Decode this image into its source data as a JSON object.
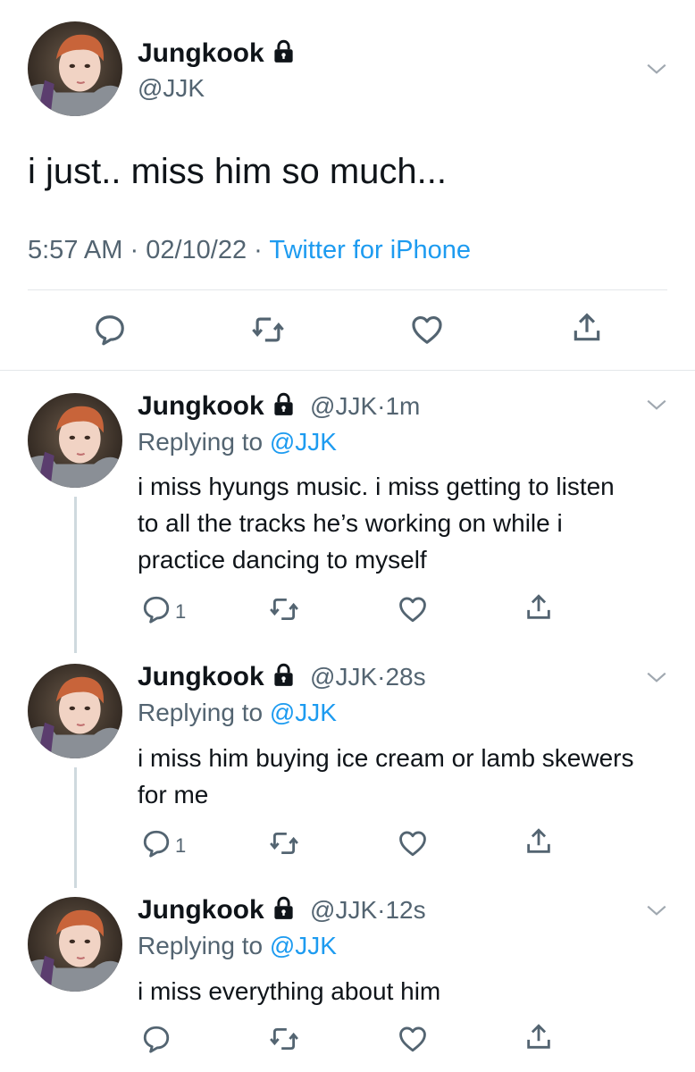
{
  "main_tweet": {
    "name": "Jungkook",
    "handle": "@JJK",
    "text": "i just.. miss him so much...",
    "time": "5:57 AM",
    "date": "02/10/22",
    "source": "Twitter for iPhone"
  },
  "replies": [
    {
      "name": "Jungkook",
      "handle": "@JJK",
      "age": "1m",
      "replying_label": "Replying to",
      "replying_to": "@JJK",
      "text": "i miss hyungs music. i miss getting to listen to all the tracks he’s working on while i practice dancing to myself",
      "reply_count": "1"
    },
    {
      "name": "Jungkook",
      "handle": "@JJK",
      "age": "28s",
      "replying_label": "Replying to",
      "replying_to": "@JJK",
      "text": "i miss him buying ice cream or lamb skewers for me",
      "reply_count": "1"
    },
    {
      "name": "Jungkook",
      "handle": "@JJK",
      "age": "12s",
      "replying_label": "Replying to",
      "replying_to": "@JJK",
      "text": "i miss everything about him",
      "reply_count": ""
    }
  ],
  "separator": "·",
  "colors": {
    "accent": "#1d9bf0",
    "muted": "#536471",
    "divider": "#e4e7ea",
    "thread": "#cfd9de"
  },
  "icons": [
    "lock-icon",
    "chevron-down-icon",
    "reply-icon",
    "retweet-icon",
    "like-icon",
    "share-icon"
  ]
}
